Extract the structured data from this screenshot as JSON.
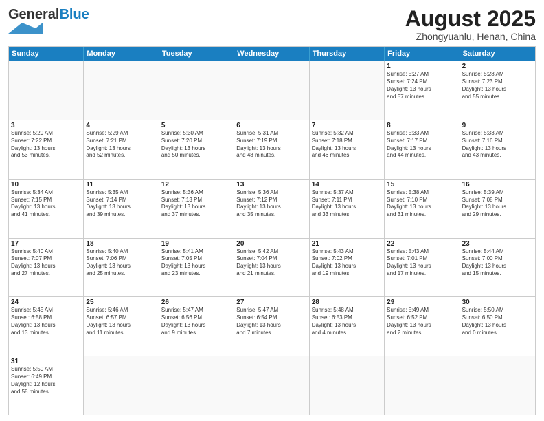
{
  "header": {
    "logo_general": "General",
    "logo_blue": "Blue",
    "month_year": "August 2025",
    "location": "Zhongyuanlu, Henan, China"
  },
  "days_of_week": [
    "Sunday",
    "Monday",
    "Tuesday",
    "Wednesday",
    "Thursday",
    "Friday",
    "Saturday"
  ],
  "weeks": [
    [
      {
        "day": "",
        "info": ""
      },
      {
        "day": "",
        "info": ""
      },
      {
        "day": "",
        "info": ""
      },
      {
        "day": "",
        "info": ""
      },
      {
        "day": "",
        "info": ""
      },
      {
        "day": "1",
        "info": "Sunrise: 5:27 AM\nSunset: 7:24 PM\nDaylight: 13 hours\nand 57 minutes."
      },
      {
        "day": "2",
        "info": "Sunrise: 5:28 AM\nSunset: 7:23 PM\nDaylight: 13 hours\nand 55 minutes."
      }
    ],
    [
      {
        "day": "3",
        "info": "Sunrise: 5:29 AM\nSunset: 7:22 PM\nDaylight: 13 hours\nand 53 minutes."
      },
      {
        "day": "4",
        "info": "Sunrise: 5:29 AM\nSunset: 7:21 PM\nDaylight: 13 hours\nand 52 minutes."
      },
      {
        "day": "5",
        "info": "Sunrise: 5:30 AM\nSunset: 7:20 PM\nDaylight: 13 hours\nand 50 minutes."
      },
      {
        "day": "6",
        "info": "Sunrise: 5:31 AM\nSunset: 7:19 PM\nDaylight: 13 hours\nand 48 minutes."
      },
      {
        "day": "7",
        "info": "Sunrise: 5:32 AM\nSunset: 7:18 PM\nDaylight: 13 hours\nand 46 minutes."
      },
      {
        "day": "8",
        "info": "Sunrise: 5:33 AM\nSunset: 7:17 PM\nDaylight: 13 hours\nand 44 minutes."
      },
      {
        "day": "9",
        "info": "Sunrise: 5:33 AM\nSunset: 7:16 PM\nDaylight: 13 hours\nand 43 minutes."
      }
    ],
    [
      {
        "day": "10",
        "info": "Sunrise: 5:34 AM\nSunset: 7:15 PM\nDaylight: 13 hours\nand 41 minutes."
      },
      {
        "day": "11",
        "info": "Sunrise: 5:35 AM\nSunset: 7:14 PM\nDaylight: 13 hours\nand 39 minutes."
      },
      {
        "day": "12",
        "info": "Sunrise: 5:36 AM\nSunset: 7:13 PM\nDaylight: 13 hours\nand 37 minutes."
      },
      {
        "day": "13",
        "info": "Sunrise: 5:36 AM\nSunset: 7:12 PM\nDaylight: 13 hours\nand 35 minutes."
      },
      {
        "day": "14",
        "info": "Sunrise: 5:37 AM\nSunset: 7:11 PM\nDaylight: 13 hours\nand 33 minutes."
      },
      {
        "day": "15",
        "info": "Sunrise: 5:38 AM\nSunset: 7:10 PM\nDaylight: 13 hours\nand 31 minutes."
      },
      {
        "day": "16",
        "info": "Sunrise: 5:39 AM\nSunset: 7:08 PM\nDaylight: 13 hours\nand 29 minutes."
      }
    ],
    [
      {
        "day": "17",
        "info": "Sunrise: 5:40 AM\nSunset: 7:07 PM\nDaylight: 13 hours\nand 27 minutes."
      },
      {
        "day": "18",
        "info": "Sunrise: 5:40 AM\nSunset: 7:06 PM\nDaylight: 13 hours\nand 25 minutes."
      },
      {
        "day": "19",
        "info": "Sunrise: 5:41 AM\nSunset: 7:05 PM\nDaylight: 13 hours\nand 23 minutes."
      },
      {
        "day": "20",
        "info": "Sunrise: 5:42 AM\nSunset: 7:04 PM\nDaylight: 13 hours\nand 21 minutes."
      },
      {
        "day": "21",
        "info": "Sunrise: 5:43 AM\nSunset: 7:02 PM\nDaylight: 13 hours\nand 19 minutes."
      },
      {
        "day": "22",
        "info": "Sunrise: 5:43 AM\nSunset: 7:01 PM\nDaylight: 13 hours\nand 17 minutes."
      },
      {
        "day": "23",
        "info": "Sunrise: 5:44 AM\nSunset: 7:00 PM\nDaylight: 13 hours\nand 15 minutes."
      }
    ],
    [
      {
        "day": "24",
        "info": "Sunrise: 5:45 AM\nSunset: 6:58 PM\nDaylight: 13 hours\nand 13 minutes."
      },
      {
        "day": "25",
        "info": "Sunrise: 5:46 AM\nSunset: 6:57 PM\nDaylight: 13 hours\nand 11 minutes."
      },
      {
        "day": "26",
        "info": "Sunrise: 5:47 AM\nSunset: 6:56 PM\nDaylight: 13 hours\nand 9 minutes."
      },
      {
        "day": "27",
        "info": "Sunrise: 5:47 AM\nSunset: 6:54 PM\nDaylight: 13 hours\nand 7 minutes."
      },
      {
        "day": "28",
        "info": "Sunrise: 5:48 AM\nSunset: 6:53 PM\nDaylight: 13 hours\nand 4 minutes."
      },
      {
        "day": "29",
        "info": "Sunrise: 5:49 AM\nSunset: 6:52 PM\nDaylight: 13 hours\nand 2 minutes."
      },
      {
        "day": "30",
        "info": "Sunrise: 5:50 AM\nSunset: 6:50 PM\nDaylight: 13 hours\nand 0 minutes."
      }
    ],
    [
      {
        "day": "31",
        "info": "Sunrise: 5:50 AM\nSunset: 6:49 PM\nDaylight: 12 hours\nand 58 minutes."
      },
      {
        "day": "",
        "info": ""
      },
      {
        "day": "",
        "info": ""
      },
      {
        "day": "",
        "info": ""
      },
      {
        "day": "",
        "info": ""
      },
      {
        "day": "",
        "info": ""
      },
      {
        "day": "",
        "info": ""
      }
    ]
  ]
}
